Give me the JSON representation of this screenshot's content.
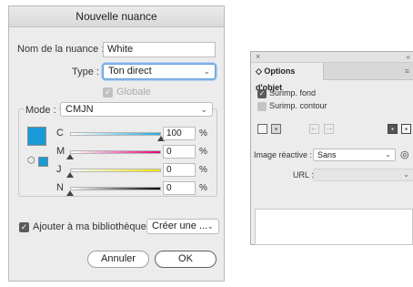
{
  "dialog": {
    "title": "Nouvelle nuance",
    "swatch_name_label": "Nom de la nuance :",
    "swatch_name_value": "White",
    "type_label": "Type :",
    "type_value": "Ton direct",
    "global_label": "Globale",
    "global_checked": true,
    "mode_label": "Mode :",
    "mode_value": "CMJN",
    "swatch_color": "#1a9ad6",
    "channels": [
      {
        "label": "C",
        "value": "100",
        "unit": "%",
        "level": 1.0,
        "color": "#28a8e0"
      },
      {
        "label": "M",
        "value": "0",
        "unit": "%",
        "level": 0.0,
        "color": "#e2057a"
      },
      {
        "label": "J",
        "value": "0",
        "unit": "%",
        "level": 0.0,
        "color": "#f4e400"
      },
      {
        "label": "N",
        "value": "0",
        "unit": "%",
        "level": 0.0,
        "color": "#000000"
      }
    ],
    "library_label": "Ajouter à ma bibliothèque",
    "library_checked": true,
    "library_select": "Créer une ...",
    "cancel_label": "Annuler",
    "ok_label": "OK"
  },
  "panel": {
    "close_glyph": "×",
    "collapse_glyph": "«",
    "tab_label": "◇ Options d'objet",
    "menu_glyph": "≡",
    "overprint_fill_label": "Surimp. fond",
    "overprint_fill_checked": true,
    "overprint_stroke_label": "Surimp. contour",
    "overprint_stroke_checked": false,
    "image_map_label": "Image réactive :",
    "image_map_value": "Sans",
    "url_label": "URL :",
    "url_value": ""
  }
}
